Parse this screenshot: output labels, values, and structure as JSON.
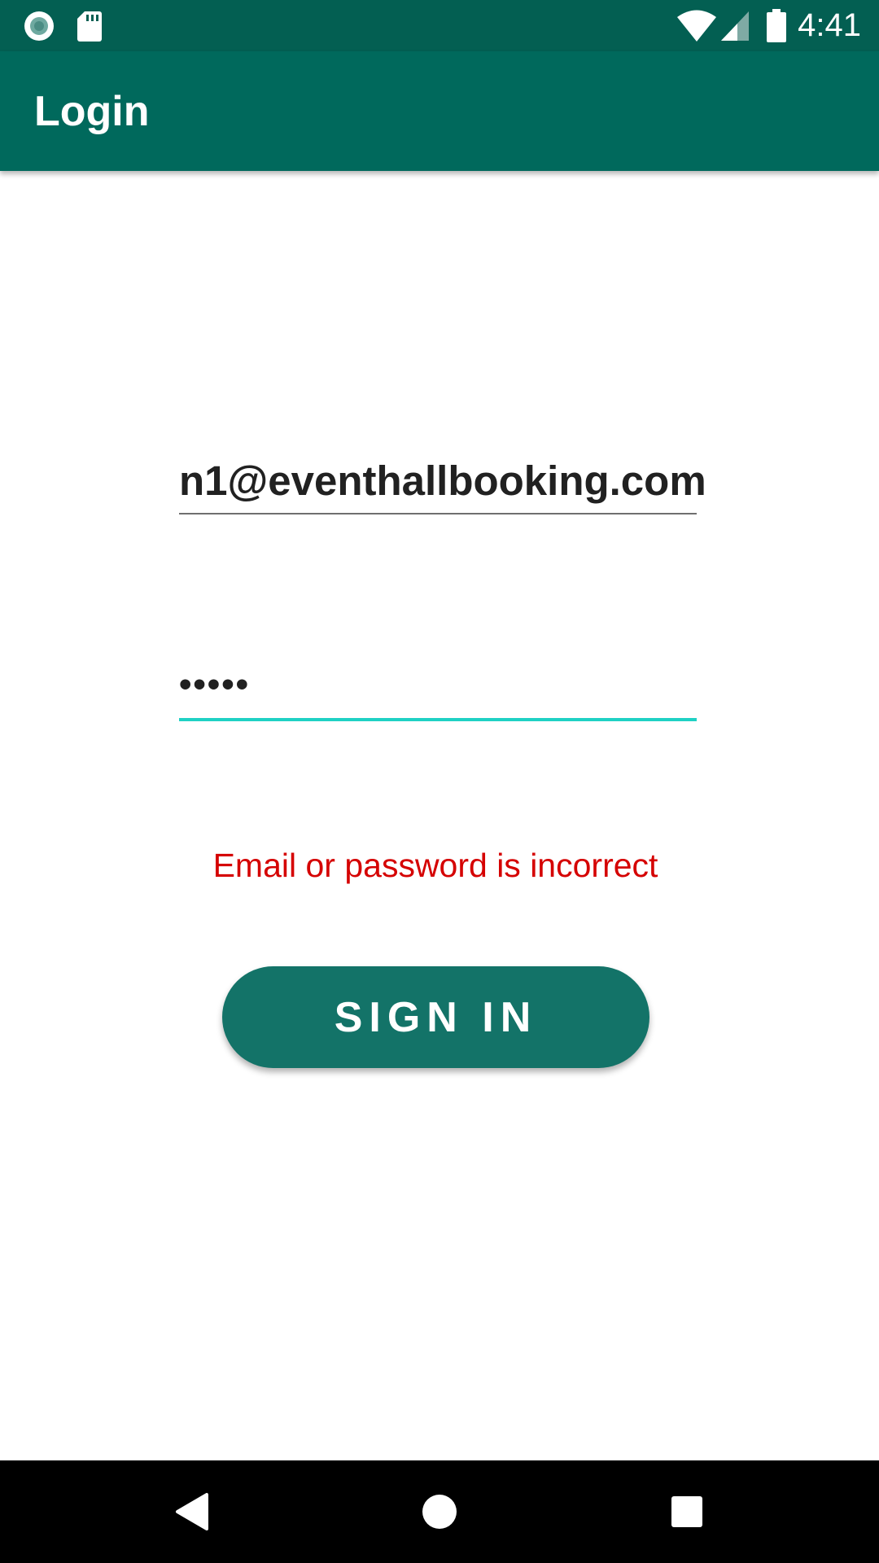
{
  "status_bar": {
    "time": "4:41",
    "left_icons": [
      "record-icon",
      "sd-card-icon"
    ],
    "right_icons": [
      "wifi-icon",
      "cell-signal-icon",
      "battery-icon"
    ],
    "color": "#035f52"
  },
  "app_bar": {
    "title": "Login",
    "color": "#00695c"
  },
  "form": {
    "email_value": "n1@eventhallbooking.com",
    "password_value": "•••••",
    "error_message": "Email or password is incorrect",
    "error_color": "#d50000",
    "focus_color": "#1fd1c4"
  },
  "sign_in_button": {
    "label": "SIGN IN",
    "color": "#137368"
  },
  "nav_bar": {
    "buttons": [
      "back-icon",
      "home-icon",
      "recents-icon"
    ]
  }
}
